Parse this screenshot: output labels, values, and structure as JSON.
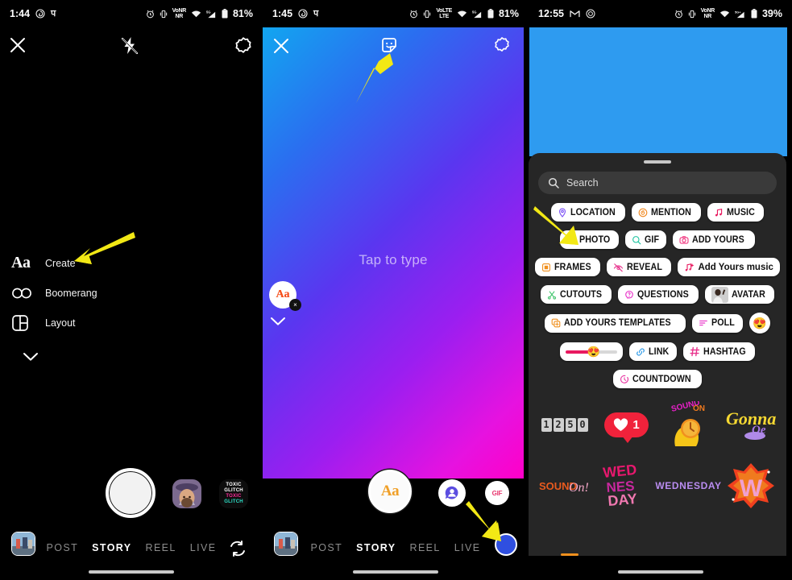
{
  "panel1": {
    "status": {
      "time": "1:44",
      "icons_left": [
        "fingerprint-icon",
        "devanagari-glyph"
      ],
      "glyph": "प",
      "alarm": "alarm-icon",
      "vibrate": "vibrate-icon",
      "net_top": "VoNR",
      "net_bottom": "NR",
      "wifi": "wifi-icon",
      "sig": "5G",
      "battery": "81%"
    },
    "topbar": {
      "close": "close-icon",
      "flash": "flash-off-icon",
      "settings": "settings-icon"
    },
    "create_menu": [
      {
        "icon": "aa-text-icon",
        "label": "Create"
      },
      {
        "icon": "boomerang-icon",
        "label": "Boomerang"
      },
      {
        "icon": "layout-icon",
        "label": "Layout"
      },
      {
        "icon": "chevron-down-icon",
        "label": ""
      }
    ],
    "effects": [
      {
        "name": "effect-face-thumb",
        "label": ""
      },
      {
        "name": "effect-toxic-glitch",
        "line1": "TOXIC",
        "line2": "GLITCH"
      }
    ],
    "modes": [
      {
        "label": "POST",
        "active": false
      },
      {
        "label": "STORY",
        "active": true
      },
      {
        "label": "REEL",
        "active": false
      },
      {
        "label": "LIVE",
        "active": false
      }
    ],
    "gallery": "gallery-thumbnail",
    "flip": "flip-camera-icon",
    "shutter": "shutter-button"
  },
  "panel2": {
    "status": {
      "time": "1:45",
      "glyph": "प",
      "net_top": "VoLTE",
      "net_bottom": "LTE",
      "battery": "81%"
    },
    "topbar": {
      "close": "close-icon",
      "sticker": "sticker-icon",
      "settings": "settings-icon"
    },
    "canvas": {
      "placeholder": "Tap to type",
      "font_bubble": "Aa",
      "font_bubble_close": "×",
      "chevron": "chevron-down-icon"
    },
    "bottom": {
      "text_button": "Aa",
      "avatar_button": "avatar-sticker-icon",
      "gif_button": "GIF",
      "color_button": "color-picker"
    },
    "modes": [
      {
        "label": "POST",
        "active": false
      },
      {
        "label": "STORY",
        "active": true
      },
      {
        "label": "REEL",
        "active": false
      },
      {
        "label": "LIVE",
        "active": false
      }
    ]
  },
  "panel3": {
    "status": {
      "time": "12:55",
      "icons": [
        "gmail-icon",
        "instagram-icon"
      ],
      "net_top": "VoNR",
      "net_bottom": "NR",
      "sig": "5G+",
      "battery": "39%"
    },
    "search": {
      "placeholder": "Search",
      "icon": "search-icon"
    },
    "sticker_rows": [
      [
        {
          "type": "chip",
          "label": "LOCATION",
          "icon": "location-pin-icon",
          "color": "#7a4ff5"
        },
        {
          "type": "chip",
          "label": "MENTION",
          "icon": "threads-at-icon",
          "color": "#f0871e"
        },
        {
          "type": "chip",
          "label": "MUSIC",
          "icon": "music-note-icon",
          "color": "#e8195f"
        }
      ],
      [
        {
          "type": "chip",
          "label": "PHOTO",
          "icon": "photo-icon",
          "color": "#2ec46a"
        },
        {
          "type": "chip",
          "label": "GIF",
          "icon": "gif-search-icon",
          "color": "#1fc4a0"
        },
        {
          "type": "chip",
          "label": "ADD YOURS",
          "icon": "camera-icon",
          "color": "#f0347e"
        }
      ],
      [
        {
          "type": "chip",
          "label": "FRAMES",
          "icon": "frames-icon",
          "color": "#f0901e"
        },
        {
          "type": "chip",
          "label": "REVEAL",
          "icon": "reveal-eye-icon",
          "color": "#e8328c"
        },
        {
          "type": "chip",
          "label": "Add Yours music",
          "icon": "music-plus-icon",
          "color": "#e8195f",
          "mixed": true
        }
      ],
      [
        {
          "type": "chip",
          "label": "CUTOUTS",
          "icon": "scissors-icon",
          "color": "#3ec46a"
        },
        {
          "type": "chip",
          "label": "QUESTIONS",
          "icon": "question-bubble-icon",
          "color": "#e832c8"
        },
        {
          "type": "chip",
          "label": "AVATAR",
          "icon": "avatar-photo-icon",
          "color": "#111111"
        }
      ],
      [
        {
          "type": "chip",
          "label": "ADD YOURS TEMPLATES",
          "icon": "templates-icon",
          "color": "#f0901e"
        },
        {
          "type": "chip",
          "label": "POLL",
          "icon": "poll-bars-icon",
          "color": "#e832c8"
        },
        {
          "type": "round",
          "label": "😍",
          "name": "emoji-sticker"
        }
      ],
      [
        {
          "type": "slider",
          "label": "",
          "name": "emoji-slider-sticker",
          "emoji": "😍"
        },
        {
          "type": "chip",
          "label": "LINK",
          "icon": "link-icon",
          "color": "#2e9be8"
        },
        {
          "type": "chip",
          "label": "HASHTAG",
          "icon": "hashtag-icon",
          "color": "#e8328c"
        }
      ],
      [
        {
          "type": "chip",
          "label": "COUNTDOWN",
          "icon": "countdown-clock-icon",
          "color": "#e832a0"
        }
      ]
    ],
    "sticker_grid": [
      [
        {
          "name": "countdown-digits-sticker",
          "digits": [
            "1",
            "2",
            "5",
            "0"
          ]
        },
        {
          "name": "like-count-sticker",
          "count": "1",
          "icon": "heart-icon"
        },
        {
          "name": "sound-on-hand-sticker",
          "text": "SOUND ON"
        },
        {
          "name": "gonna-sticker",
          "text": "Gonna"
        }
      ],
      [
        {
          "name": "sound-on-text-sticker",
          "text": "SOUND ON!"
        },
        {
          "name": "wednesday-bubble-sticker",
          "text": "WED NES DAY"
        },
        {
          "name": "wednesday-plain-sticker",
          "text": "WEDNESDAY"
        },
        {
          "name": "w-burst-sticker",
          "text": "W"
        }
      ]
    ]
  },
  "annotations": {
    "arrow1": "arrow-pointing-create",
    "arrow2": "arrow-pointing-sticker-icon",
    "arrow3": "arrow-pointing-photo-chip",
    "arrow4": "arrow-pointing-color-button",
    "color": "#f2e815"
  }
}
